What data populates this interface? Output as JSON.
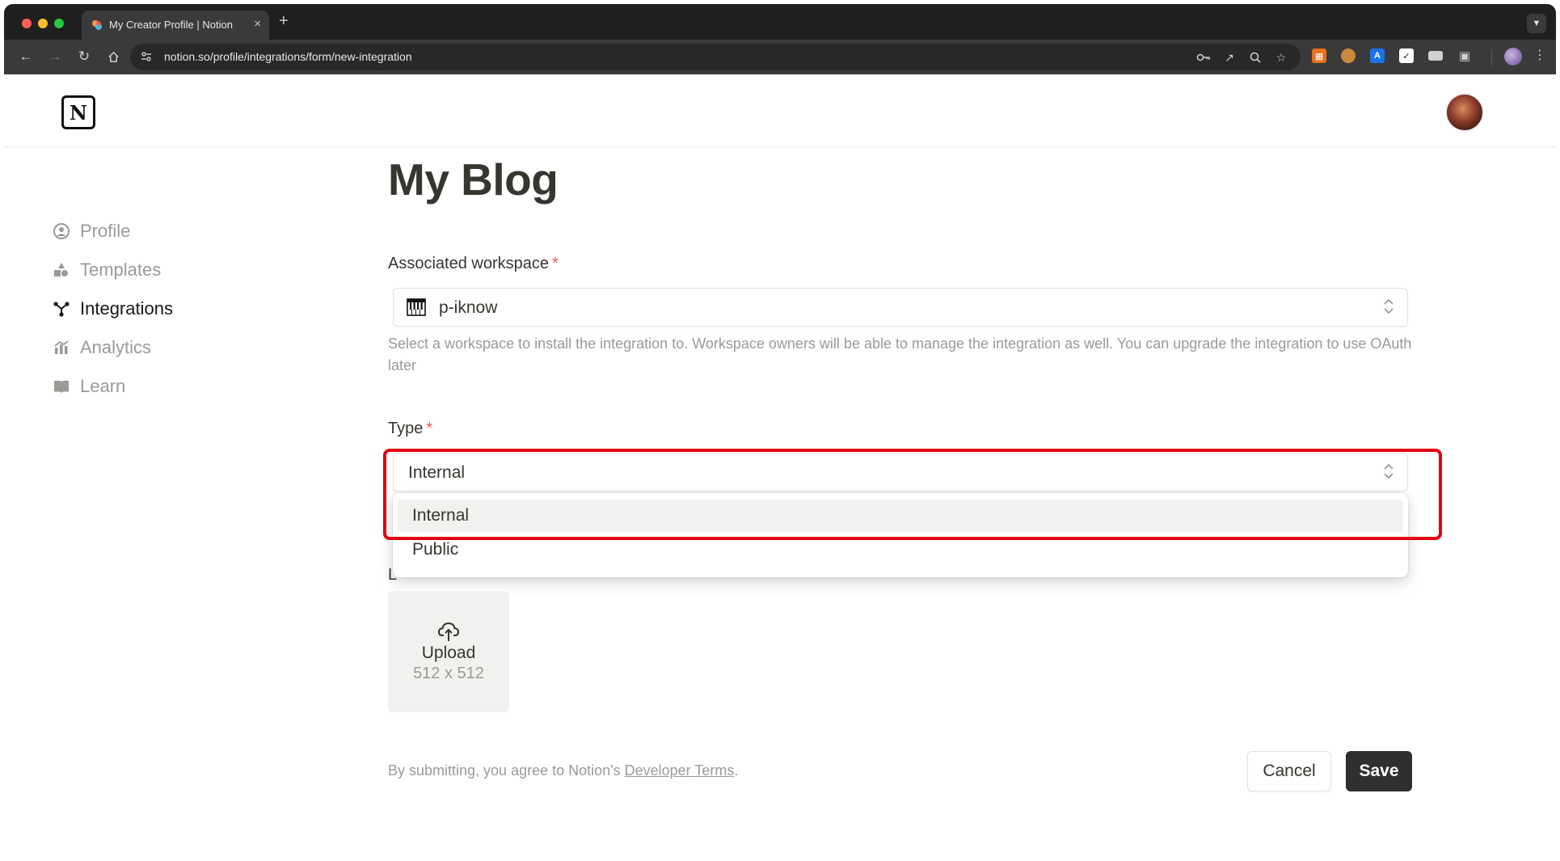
{
  "browser": {
    "tab_title": "My Creator Profile | Notion",
    "url": "notion.so/profile/integrations/form/new-integration",
    "new_tab_label": "+",
    "tab_close_label": "×",
    "extension_icons": [
      "password-key-icon",
      "open-in-new-icon",
      "zoom-icon",
      "bookmark-star-icon",
      "calculator-extension-icon",
      "cookie-extension-icon",
      "translate-extension-icon",
      "notion-clipper-extension-icon",
      "reader-extension-icon",
      "extensions-puzzle-icon"
    ],
    "extension_labels": {
      "translate": "A"
    }
  },
  "sidebar": {
    "items": [
      {
        "label": "Profile",
        "icon": "profile-icon",
        "active": false
      },
      {
        "label": "Templates",
        "icon": "templates-icon",
        "active": false
      },
      {
        "label": "Integrations",
        "icon": "integrations-icon",
        "active": true
      },
      {
        "label": "Analytics",
        "icon": "analytics-icon",
        "active": false
      },
      {
        "label": "Learn",
        "icon": "learn-book-icon",
        "active": false
      }
    ]
  },
  "form": {
    "title": "My Blog",
    "workspace_label": "Associated workspace",
    "required_mark": "*",
    "workspace_value": "p-iknow",
    "workspace_help": "Select a workspace to install the integration to. Workspace owners will be able to manage the integration as well. You can upgrade the integration to use OAuth later",
    "type_label": "Type",
    "type_value": "Internal",
    "type_options": [
      "Internal",
      "Public"
    ],
    "hovered_option": "Internal",
    "logo_label_visible_fragment": "L",
    "upload_label": "Upload",
    "upload_size": "512 x 512",
    "terms_prefix": "By submitting, you agree to Notion's ",
    "terms_link": "Developer Terms",
    "terms_suffix": ".",
    "cancel_label": "Cancel",
    "save_label": "Save"
  },
  "colors": {
    "highlight": "#e3000f",
    "required": "#eb5757",
    "save_bg": "#2f2f2f"
  }
}
